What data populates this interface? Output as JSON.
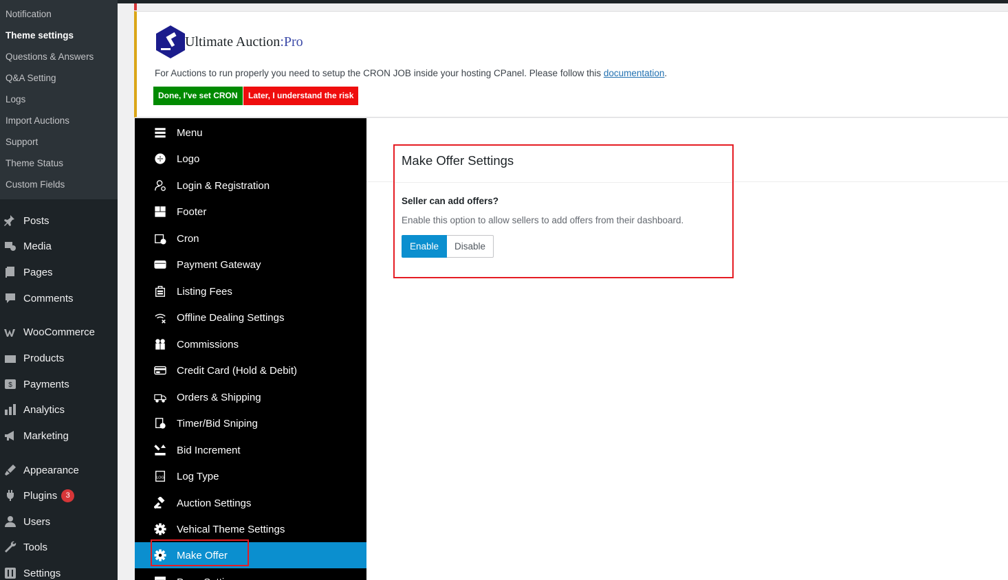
{
  "wp_submenu": [
    {
      "label": "Notification",
      "current": false
    },
    {
      "label": "Theme settings",
      "current": true
    },
    {
      "label": "Questions & Answers",
      "current": false
    },
    {
      "label": "Q&A Setting",
      "current": false
    },
    {
      "label": "Logs",
      "current": false
    },
    {
      "label": "Import Auctions",
      "current": false
    },
    {
      "label": "Support",
      "current": false
    },
    {
      "label": "Theme Status",
      "current": false
    },
    {
      "label": "Custom Fields",
      "current": false
    }
  ],
  "wp_menu": [
    {
      "label": "Posts",
      "icon": "pin-icon"
    },
    {
      "label": "Media",
      "icon": "media-icon"
    },
    {
      "label": "Pages",
      "icon": "pages-icon"
    },
    {
      "label": "Comments",
      "icon": "comments-icon"
    },
    {
      "label": "WooCommerce",
      "icon": "woocommerce-icon"
    },
    {
      "label": "Products",
      "icon": "products-icon"
    },
    {
      "label": "Payments",
      "icon": "payments-icon"
    },
    {
      "label": "Analytics",
      "icon": "analytics-icon"
    },
    {
      "label": "Marketing",
      "icon": "megaphone-icon"
    },
    {
      "label": "Appearance",
      "icon": "brush-icon"
    },
    {
      "label": "Plugins",
      "icon": "plugin-icon",
      "badge": "3"
    },
    {
      "label": "Users",
      "icon": "user-icon"
    },
    {
      "label": "Tools",
      "icon": "wrench-icon"
    },
    {
      "label": "Settings",
      "icon": "settings-icon"
    }
  ],
  "notice": {
    "brand_name": "Ultimate Auction",
    "brand_suffix": ":Pro",
    "text": "For Auctions to run properly you need to setup the CRON JOB inside your hosting CPanel. Please follow this ",
    "link_text": "documentation",
    "text_end": ".",
    "done_button": "Done, I've set CRON",
    "later_button": "Later, I understand the risk"
  },
  "settings_nav": [
    {
      "label": "Menu",
      "icon": "hamburger-icon"
    },
    {
      "label": "Logo",
      "icon": "plus-circle-icon"
    },
    {
      "label": "Login & Registration",
      "icon": "user-login-icon"
    },
    {
      "label": "Footer",
      "icon": "footer-layout-icon"
    },
    {
      "label": "Cron",
      "icon": "calendar-clock-icon"
    },
    {
      "label": "Payment Gateway",
      "icon": "credit-card-icon"
    },
    {
      "label": "Listing Fees",
      "icon": "receipt-icon"
    },
    {
      "label": "Offline Dealing Settings",
      "icon": "wifi-off-icon"
    },
    {
      "label": "Commissions",
      "icon": "people-icon"
    },
    {
      "label": "Credit Card (Hold & Debit)",
      "icon": "card-hold-icon"
    },
    {
      "label": "Orders & Shipping",
      "icon": "truck-icon"
    },
    {
      "label": "Timer/Bid Sniping",
      "icon": "timer-doc-icon"
    },
    {
      "label": "Bid Increment",
      "icon": "bid-increment-icon"
    },
    {
      "label": "Log Type",
      "icon": "log-file-icon"
    },
    {
      "label": "Auction Settings",
      "icon": "gavel-icon"
    },
    {
      "label": "Vehical Theme Settings",
      "icon": "gear-icon"
    },
    {
      "label": "Make Offer",
      "icon": "gear-icon",
      "active": true
    },
    {
      "label": "Page Settings",
      "icon": "page-settings-icon"
    }
  ],
  "make_offer": {
    "title": "Make Offer Settings",
    "field_label": "Seller can add offers?",
    "field_desc": "Enable this option to allow sellers to add offers from their dashboard.",
    "enable_label": "Enable",
    "disable_label": "Disable",
    "selected": "Enable"
  },
  "colors": {
    "accent": "#0b8fcf",
    "highlight_border": "#e51c23",
    "done_green": "#008a00",
    "later_red": "#ef0d0d"
  }
}
